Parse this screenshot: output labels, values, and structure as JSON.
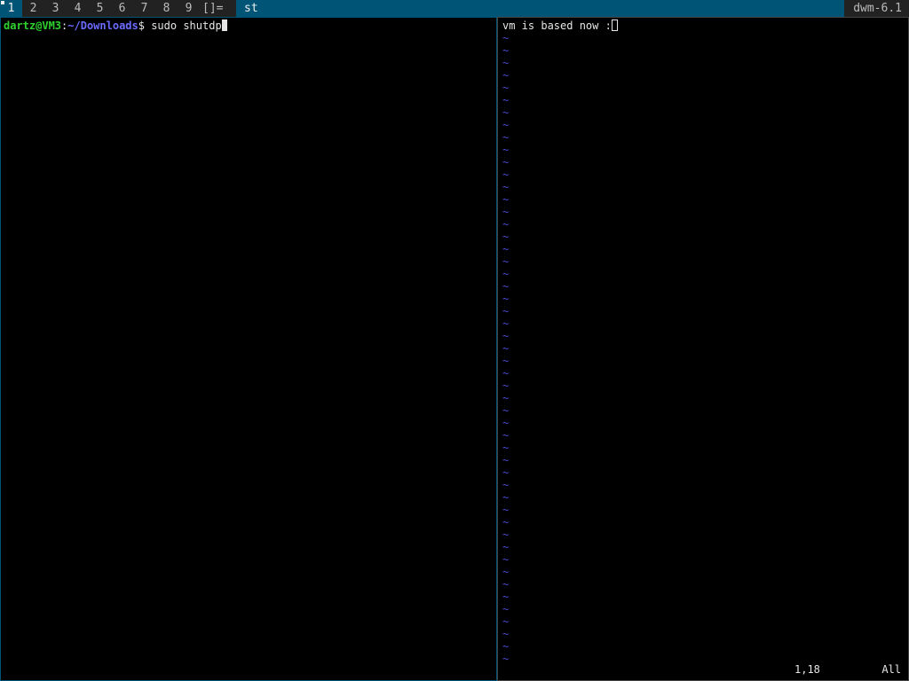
{
  "bar": {
    "tags": [
      "1",
      "2",
      "3",
      "4",
      "5",
      "6",
      "7",
      "8",
      "9"
    ],
    "selected_tag": "1",
    "layout_symbol": "[]=",
    "window_title": "st",
    "status_text": "dwm-6.1"
  },
  "terminal": {
    "user_host": "dartz@VM3",
    "colon": ":",
    "path": "~/Downloads",
    "prompt_symbol": "$ ",
    "command": "sudo shutdp"
  },
  "vim": {
    "text_line": "vm is based now :",
    "tilde": "~",
    "tilde_count": 51,
    "cursor_position": "1,18",
    "scroll_indicator": "All"
  },
  "colors": {
    "bar_bg": "#222222",
    "accent": "#005577",
    "user_green": "#2fd12f",
    "path_blue": "#6b6bff",
    "tilde_blue": "#4c4cd9"
  }
}
